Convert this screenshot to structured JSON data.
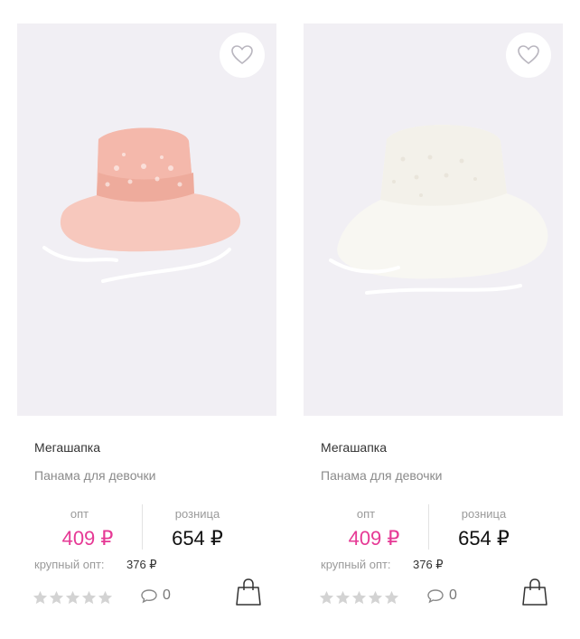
{
  "products": [
    {
      "brand": "Мегашапка",
      "title": "Панама для девочки",
      "opt_label": "опт",
      "opt_price": "409 ₽",
      "retail_label": "розница",
      "retail_price": "654 ₽",
      "bulk_label": "крупный опт:",
      "bulk_price": "376 ₽",
      "rating": 0,
      "comments": "0",
      "hat_color": "#f7c8bd",
      "fav_icon": "heart-icon",
      "cart_icon": "shopping-bag-icon",
      "comment_icon": "speech-bubble-icon"
    },
    {
      "brand": "Мегашапка",
      "title": "Панама для девочки",
      "opt_label": "опт",
      "opt_price": "409 ₽",
      "retail_label": "розница",
      "retail_price": "654 ₽",
      "bulk_label": "крупный опт:",
      "bulk_price": "376 ₽",
      "rating": 0,
      "comments": "0",
      "hat_color": "#f8f7f2",
      "fav_icon": "heart-icon",
      "cart_icon": "shopping-bag-icon",
      "comment_icon": "speech-bubble-icon"
    }
  ],
  "colors": {
    "opt_price": "#e63995",
    "image_bg": "#f1eff4",
    "star_empty": "#d3d3d3"
  }
}
